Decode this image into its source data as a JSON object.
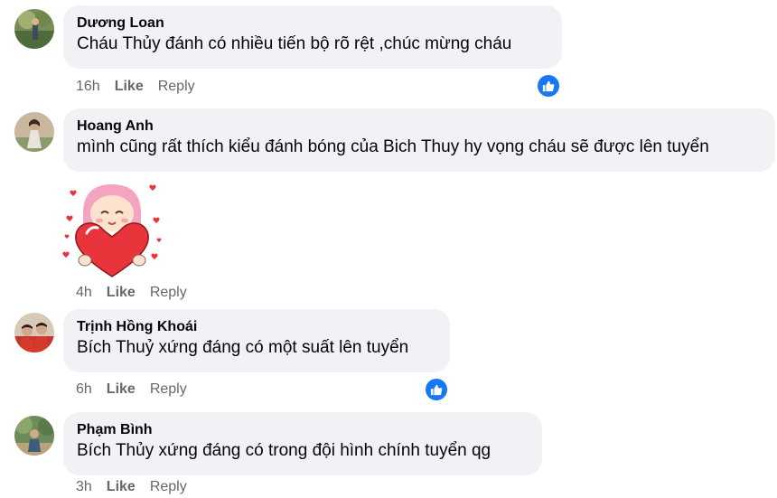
{
  "comments": [
    {
      "author": "Dương Loan",
      "text": "Cháu Thủy đánh có nhiều tiến bộ rõ rệt ,chúc mừng cháu",
      "time": "16h",
      "like_label": "Like",
      "reply_label": "Reply"
    },
    {
      "author": "Hoang Anh",
      "text": "mình cũng rất thích kiểu đánh bóng của Bich Thuy hy vọng cháu sẽ được lên tuyển",
      "time": "4h",
      "like_label": "Like",
      "reply_label": "Reply"
    },
    {
      "author": "Trịnh Hồng Khoái",
      "text": "Bích Thuỷ xứng đáng có một suất lên tuyển",
      "time": "6h",
      "like_label": "Like",
      "reply_label": "Reply"
    },
    {
      "author": "Phạm Bình",
      "text": "Bích Thủy xứng đáng có trong đội hình chính tuyển qg",
      "time": "3h",
      "like_label": "Like",
      "reply_label": "Reply"
    }
  ],
  "colors": {
    "bubble": "#f0f2f5",
    "meta_text": "#65676b",
    "like_blue": "#1877f2",
    "heart_red": "#e8343a"
  },
  "icons": {
    "reaction": "like-thumb-icon",
    "sticker": "heart-hug-sticker"
  }
}
